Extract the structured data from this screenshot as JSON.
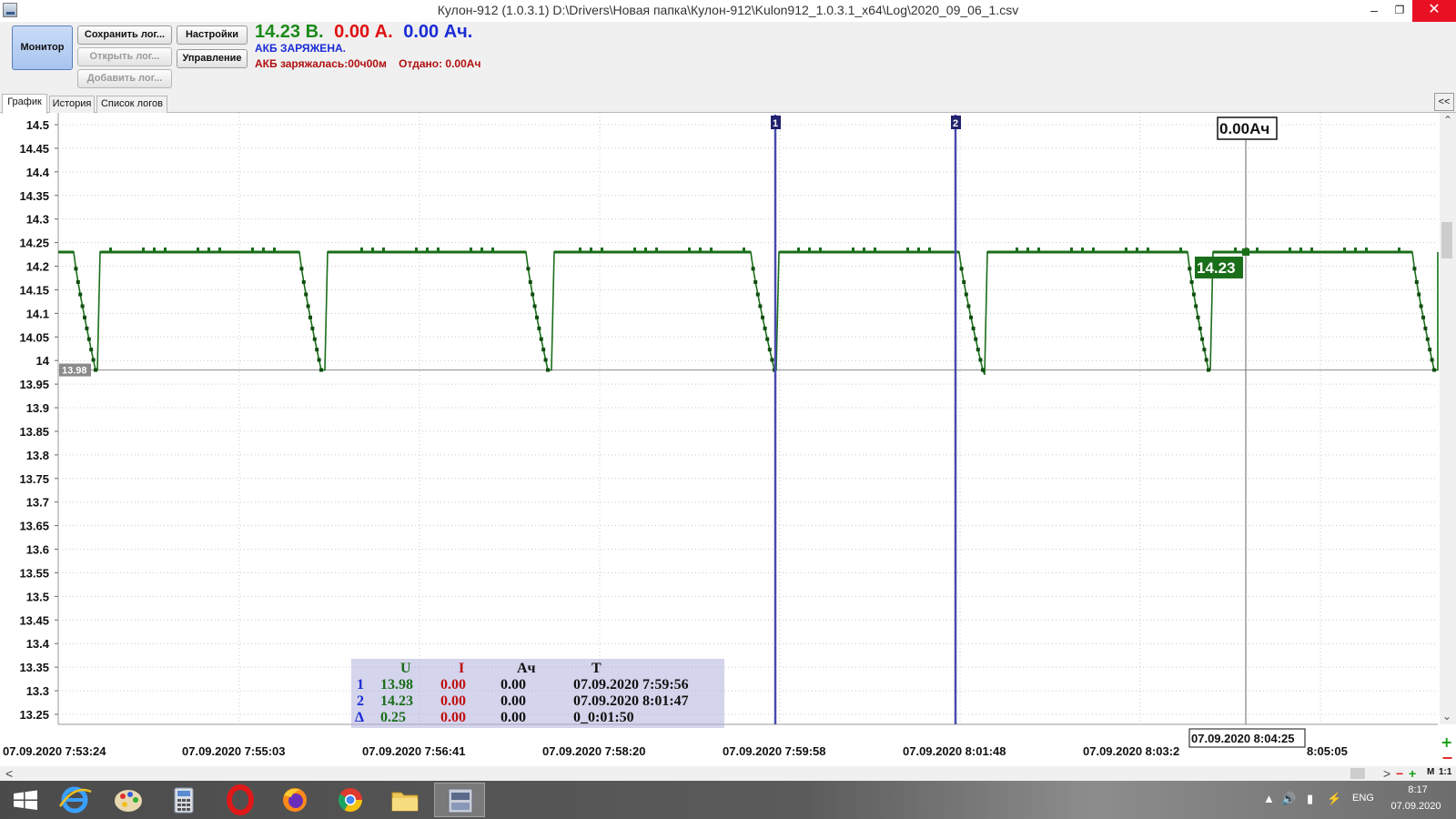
{
  "window": {
    "title": "Кулон-912 (1.0.3.1) D:\\Drivers\\Новая папка\\Кулон-912\\Kulon912_1.0.3.1_x64\\Log\\2020_09_06_1.csv",
    "minimize": "–",
    "maximize": "❐",
    "close": "✕"
  },
  "toolbar": {
    "monitor": "Монитор",
    "save_log": "Сохранить лог...",
    "open_log": "Открыть лог...",
    "add_log": "Добавить лог...",
    "settings": "Настройки",
    "control": "Управление"
  },
  "readings": {
    "voltage": "14.23 В.",
    "current": "0.00 А.",
    "capacity": "0.00 Ач.",
    "voltage_color": "#1a8a1a",
    "current_color": "#e01010",
    "capacity_color": "#1a2bd6"
  },
  "status": {
    "charged": "АКБ ЗАРЯЖЕНА.",
    "charging_time": "АКБ заряжалась:00ч00м",
    "given": "Отдано: 0.00Ач"
  },
  "tabs": {
    "graph": "График",
    "history": "История",
    "logs": "Список логов",
    "collapse": "<<"
  },
  "chart_data": {
    "type": "line",
    "series": [
      {
        "color": "#1a6e1a"
      }
    ],
    "y_ticks": [
      "14.5",
      "14.45",
      "14.4",
      "14.35",
      "14.3",
      "14.25",
      "14.2",
      "14.15",
      "14.1",
      "14.05",
      "14",
      "13.95",
      "13.9",
      "13.85",
      "13.8",
      "13.75",
      "13.7",
      "13.65",
      "13.6",
      "13.55",
      "13.5",
      "13.45",
      "13.4",
      "13.35",
      "13.3",
      "13.25"
    ],
    "ylim": [
      13.25,
      14.5
    ],
    "x_ticks": [
      "07.09.2020 7:53:24",
      "07.09.2020 7:55:03",
      "07.09.2020 7:56:41",
      "07.09.2020 7:58:20",
      "07.09.2020 7:59:58",
      "07.09.2020 8:01:48",
      "07.09.2020 8:03:2",
      "8:05:05"
    ],
    "grid": true,
    "min_label": "13.98",
    "cursor1_label": "1",
    "cursor2_label": "2",
    "pointer_ah": "0.00Ач",
    "pointer_value": "14.23",
    "pointer_time": "07.09.2020 8:04:25",
    "cycle_high": 14.23,
    "cycle_low": 13.98
  },
  "cursor_table": {
    "headers": {
      "u": "U",
      "i": "I",
      "ah": "Ач",
      "t": "T"
    },
    "rows": [
      {
        "id": "1",
        "u": "13.98",
        "i": "0.00",
        "ah": "0.00",
        "t": "07.09.2020 7:59:56"
      },
      {
        "id": "2",
        "u": "14.23",
        "i": "0.00",
        "ah": "0.00",
        "t": "07.09.2020 8:01:47"
      },
      {
        "id": "Δ",
        "u": "0.25",
        "i": "0.00",
        "ah": "0.00",
        "t": "0_0:01:50"
      }
    ]
  },
  "scrollbar": {
    "left_arrow": "<",
    "right_arrow": ">",
    "zoom_out": "−",
    "zoom_in": "+",
    "m": "M",
    "scale": "1:1",
    "v_up": "+",
    "v_down": "−"
  },
  "taskbar": {
    "tray_chevron": "▲",
    "tray_sound": "🔊",
    "tray_net": "▮",
    "tray_power": "⚡",
    "lang": "ENG",
    "time": "8:17",
    "date": "07.09.2020"
  }
}
